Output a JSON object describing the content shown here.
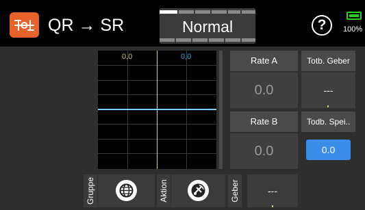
{
  "header": {
    "title": "QR → SR",
    "mode": "Normal",
    "battery": "100%",
    "help": "?"
  },
  "graph": {
    "label_left": "0,0",
    "label_right": "0,0",
    "label_left_color": "#c8c870",
    "label_right_color": "#3f9fe0"
  },
  "rate_a": {
    "label": "Rate A",
    "value": "0.0"
  },
  "rate_b": {
    "label": "Rate B",
    "value": "0.0"
  },
  "totb_geber": {
    "label": "Totb. Geber",
    "value": "---"
  },
  "todb_spei": {
    "label": "Todb. Spei..",
    "value": "0.0"
  },
  "toolbar": {
    "gruppe_label": "Gruppe",
    "aktion_label": "Aktion",
    "geber_label": "Geber",
    "geber_value": "---",
    "gruppe_icon": "globe-icon",
    "aktion_icon": "satellite-icon"
  },
  "colors": {
    "accent": "#e8632b",
    "highlight": "#3b8dea",
    "curve": "#6fd8f2",
    "axis": "#d8d870"
  }
}
